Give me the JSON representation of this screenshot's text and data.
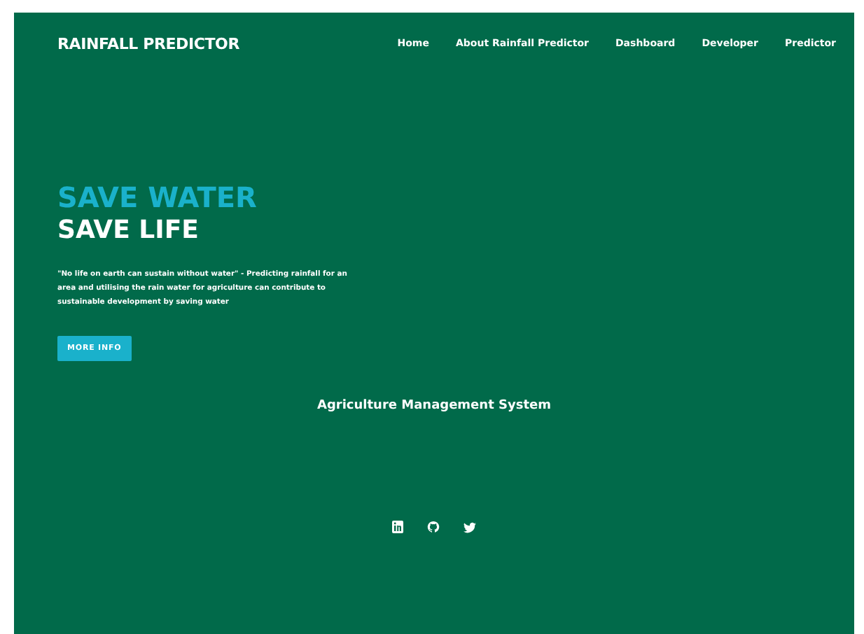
{
  "brand": "RAINFALL PREDICTOR",
  "nav": [
    {
      "label": "Home"
    },
    {
      "label": "About Rainfall Predictor"
    },
    {
      "label": "Dashboard"
    },
    {
      "label": "Developer"
    },
    {
      "label": "Predictor"
    }
  ],
  "hero": {
    "title_line_1": "SAVE WATER",
    "title_line_2": "SAVE LIFE",
    "description": "\"No life on earth can sustain without water\" - Predicting rainfall for an area and utilising the rain water for agriculture can contribute to sustainable development by saving water",
    "button": "MORE INFO"
  },
  "footer": {
    "title": "Agriculture Management System",
    "social_links": [
      {
        "kind": "linkedin"
      },
      {
        "kind": "github"
      },
      {
        "kind": "twitter"
      }
    ]
  }
}
